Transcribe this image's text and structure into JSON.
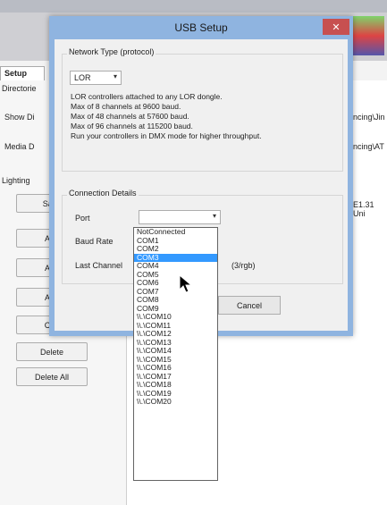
{
  "background": {
    "tab": "Setup",
    "labels": [
      "Directorie",
      "Show Di",
      "Media D",
      "Lighting"
    ],
    "buttons": [
      "Save",
      "Add",
      "Add",
      "Add",
      "Cha",
      "Delete",
      "Delete All"
    ],
    "right_texts": [
      "ncing\\Jin",
      "ncing\\AT",
      "E1.31 Uni"
    ]
  },
  "dialog": {
    "title": "USB Setup",
    "close": "✕",
    "network_group": "Network Type (protocol)",
    "network_value": "LOR",
    "description": [
      "LOR controllers attached to any LOR dongle.",
      "Max of 8 channels at 9600 baud.",
      "Max of 48 channels at 57600 baud.",
      "Max of 96 channels at 115200 baud.",
      "Run your controllers in DMX mode for higher throughput."
    ],
    "connection_group": "Connection Details",
    "port_label": "Port",
    "baud_label": "Baud Rate",
    "last_channel_label": "Last Channel",
    "last_channel_suffix": "(3/rgb)",
    "cancel": "Cancel"
  },
  "dropdown": {
    "selected": "COM3",
    "options": [
      "NotConnected",
      "COM1",
      "COM2",
      "COM3",
      "COM4",
      "COM5",
      "COM6",
      "COM7",
      "COM8",
      "COM9",
      "\\\\.\\COM10",
      "\\\\.\\COM11",
      "\\\\.\\COM12",
      "\\\\.\\COM13",
      "\\\\.\\COM14",
      "\\\\.\\COM15",
      "\\\\.\\COM16",
      "\\\\.\\COM17",
      "\\\\.\\COM18",
      "\\\\.\\COM19",
      "\\\\.\\COM20"
    ]
  }
}
